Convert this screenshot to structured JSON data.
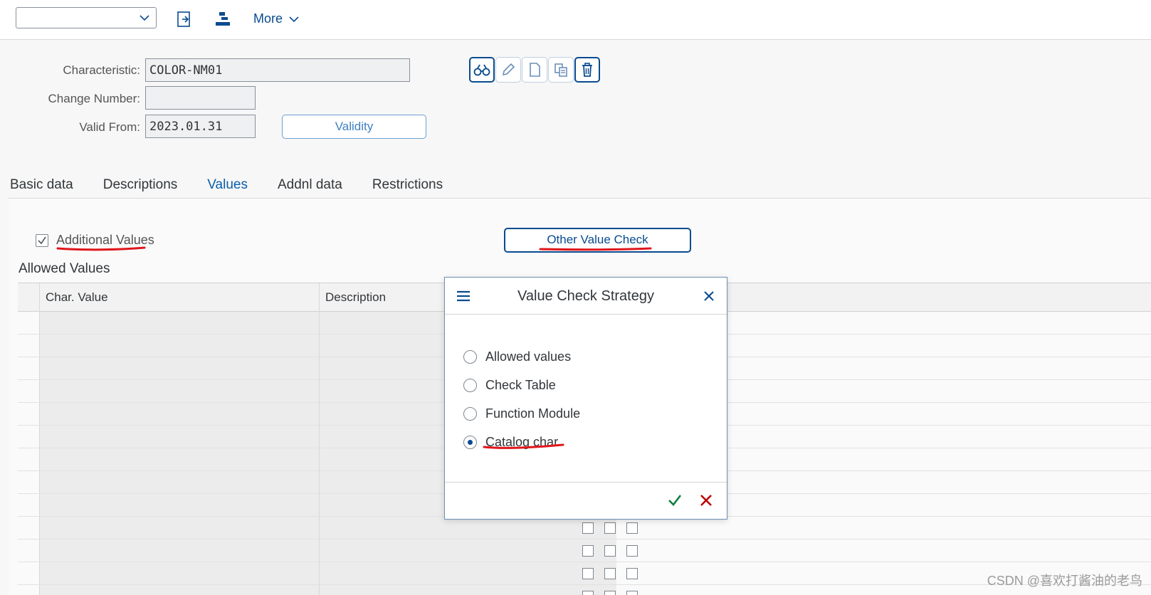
{
  "toolbar": {
    "select_value": "",
    "more_label": "More",
    "icons": [
      "export-icon",
      "hierarchy-icon"
    ]
  },
  "header": {
    "characteristic_label": "Characteristic:",
    "characteristic_value": "COLOR-NM01",
    "change_number_label": "Change Number:",
    "change_number_value": "",
    "valid_from_label": "Valid From:",
    "valid_from_value": "2023.01.31",
    "validity_button": "Validity",
    "action_icons": [
      "display-icon",
      "edit-icon",
      "new-icon",
      "copy-icon",
      "delete-icon"
    ]
  },
  "tabs": [
    {
      "label": "Basic data",
      "active": false
    },
    {
      "label": "Descriptions",
      "active": false
    },
    {
      "label": "Values",
      "active": true
    },
    {
      "label": "Addnl data",
      "active": false
    },
    {
      "label": "Restrictions",
      "active": false
    }
  ],
  "values_tab": {
    "additional_values_label": "Additional Values",
    "additional_values_checked": true,
    "other_value_check_button": "Other Value Check",
    "allowed_values_title": "Allowed Values",
    "table": {
      "columns": [
        "Char. Value",
        "Description"
      ]
    }
  },
  "dialog": {
    "title": "Value Check Strategy",
    "options": [
      {
        "label": "Allowed values",
        "selected": false
      },
      {
        "label": "Check Table",
        "selected": false
      },
      {
        "label": "Function Module",
        "selected": false
      },
      {
        "label": "Catalog char",
        "selected": true
      }
    ],
    "colors": {
      "ok": "#107e3e",
      "cancel": "#bb0000"
    }
  },
  "watermark": "CSDN @喜欢打酱油的老鸟"
}
